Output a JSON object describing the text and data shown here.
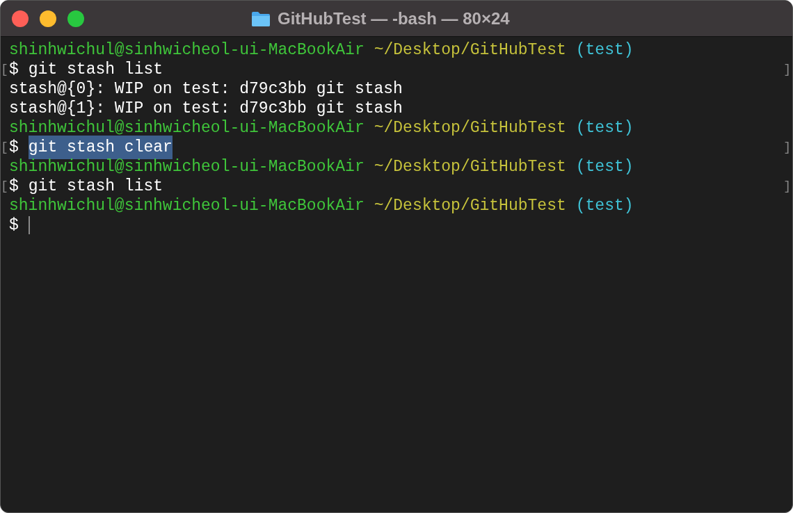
{
  "window": {
    "title": "GitHubTest — -bash — 80×24"
  },
  "lines": [
    {
      "kind": "prompt",
      "user": "shinhwichul@sinhwicheol-ui-MacBookAir",
      "path": "~/Desktop/GitHubTest",
      "branch": "(test)"
    },
    {
      "kind": "command",
      "open_bracket": "[",
      "sign": "$",
      "command": "git stash list",
      "selected": false,
      "close_bracket": "]"
    },
    {
      "kind": "output",
      "text": "stash@{0}: WIP on test: d79c3bb git stash"
    },
    {
      "kind": "output",
      "text": "stash@{1}: WIP on test: d79c3bb git stash"
    },
    {
      "kind": "prompt",
      "user": "shinhwichul@sinhwicheol-ui-MacBookAir",
      "path": "~/Desktop/GitHubTest",
      "branch": "(test)"
    },
    {
      "kind": "command",
      "open_bracket": "[",
      "sign": "$",
      "command": "git stash clear",
      "selected": true,
      "close_bracket": "]"
    },
    {
      "kind": "prompt",
      "user": "shinhwichul@sinhwicheol-ui-MacBookAir",
      "path": "~/Desktop/GitHubTest",
      "branch": "(test)"
    },
    {
      "kind": "command",
      "open_bracket": "[",
      "sign": "$",
      "command": "git stash list",
      "selected": false,
      "close_bracket": "]"
    },
    {
      "kind": "prompt",
      "user": "shinhwichul@sinhwicheol-ui-MacBookAir",
      "path": "~/Desktop/GitHubTest",
      "branch": "(test)"
    },
    {
      "kind": "input",
      "sign": "$"
    }
  ]
}
